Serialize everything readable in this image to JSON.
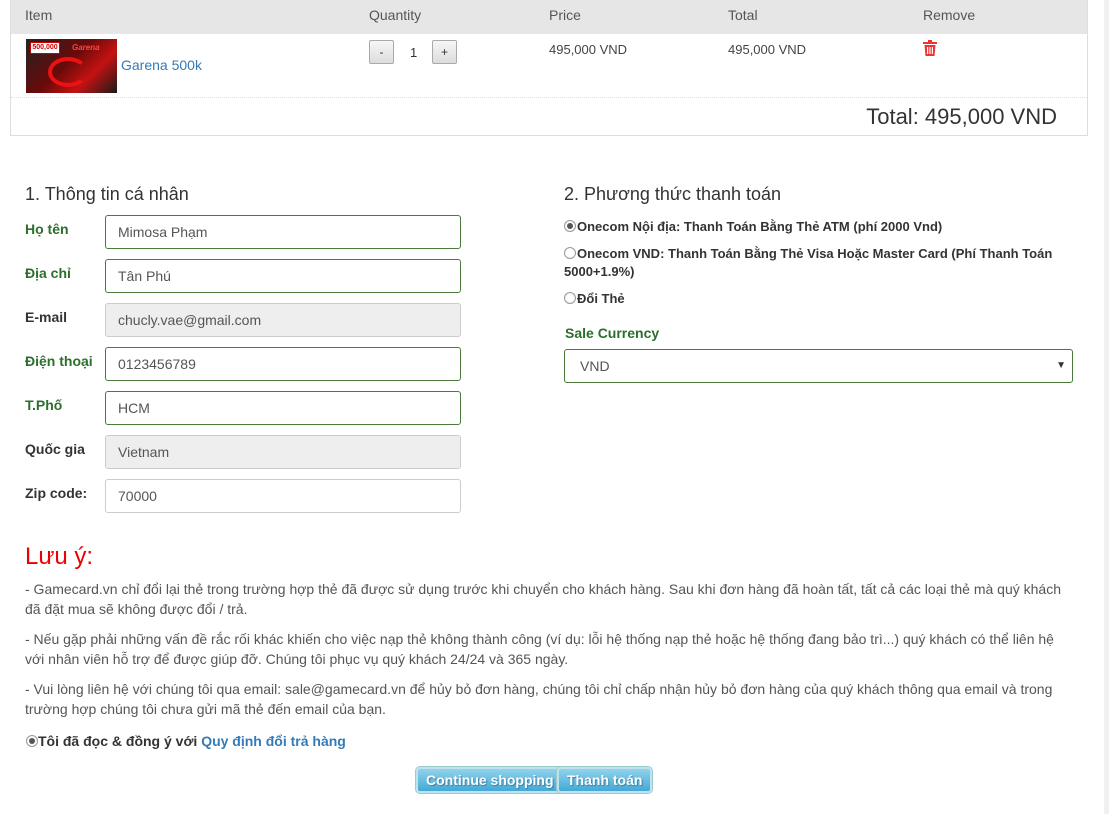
{
  "cart": {
    "headers": {
      "item": "Item",
      "quantity": "Quantity",
      "price": "Price",
      "total": "Total",
      "remove": "Remove"
    },
    "item": {
      "name": "Garena 500k",
      "thumb_badge": "500,000",
      "thumb_brand": "Garena",
      "quantity": "1",
      "minus_label": "-",
      "plus_label": "+",
      "price": "495,000 VND",
      "total": "495,000 VND"
    },
    "grand_total": "Total: 495,000 VND"
  },
  "personal": {
    "title": "1. Thông tin cá nhân",
    "fields": {
      "name": {
        "label": "Họ tên",
        "value": "Mimosa Phạm"
      },
      "address": {
        "label": "Địa chỉ",
        "value": "Tân Phú"
      },
      "email": {
        "label": "E-mail",
        "value": "chucly.vae@gmail.com"
      },
      "phone": {
        "label": "Điện thoại",
        "value": "0123456789"
      },
      "city": {
        "label": "T.Phố",
        "value": "HCM"
      },
      "country": {
        "label": "Quốc gia",
        "value": "Vietnam"
      },
      "zip": {
        "label": "Zip code:",
        "value": "70000"
      }
    }
  },
  "payment": {
    "title": "2. Phương thức thanh toán",
    "options": [
      {
        "label": "Onecom Nội địa: Thanh Toán Bằng Thẻ ATM (phí 2000 Vnd)",
        "selected": true
      },
      {
        "label": "Onecom VND: Thanh Toán Bằng Thẻ Visa Hoặc Master Card (Phí Thanh Toán 5000+1.9%)",
        "selected": false
      },
      {
        "label": "Đổi Thẻ",
        "selected": false
      }
    ],
    "currency_label": "Sale Currency",
    "currency_value": "VND"
  },
  "notes": {
    "title": "Lưu ý:",
    "items": [
      "- Gamecard.vn chỉ đổi lại thẻ trong trường hợp thẻ đã được sử dụng trước khi chuyển cho khách hàng. Sau khi đơn hàng đã hoàn tất, tất cả các loại thẻ mà quý khách đã đặt mua sẽ không được đổi / trả.",
      "- Nếu gặp phải những vấn đề rắc rối khác khiến cho việc nạp thẻ không thành công (ví dụ: lỗi hệ thống nạp thẻ hoặc hệ thống đang bảo trì...) quý khách có thể liên hệ với nhân viên hỗ trợ để được giúp đỡ. Chúng tôi phục vụ quý khách 24/24 và 365 ngày.",
      "- Vui lòng liên hệ với chúng tôi qua email: sale@gamecard.vn để hủy bỏ đơn hàng, chúng tôi chỉ chấp nhận hủy bỏ đơn hàng của quý khách thông qua email và trong trường hợp chúng tôi chưa gửi mã thẻ đến email của bạn."
    ],
    "agree_text": "Tôi đã đọc & đồng ý với ",
    "agree_link": "Quy định đổi trả hàng"
  },
  "buttons": {
    "continue": "Continue shopping",
    "checkout": "Thanh toán"
  }
}
